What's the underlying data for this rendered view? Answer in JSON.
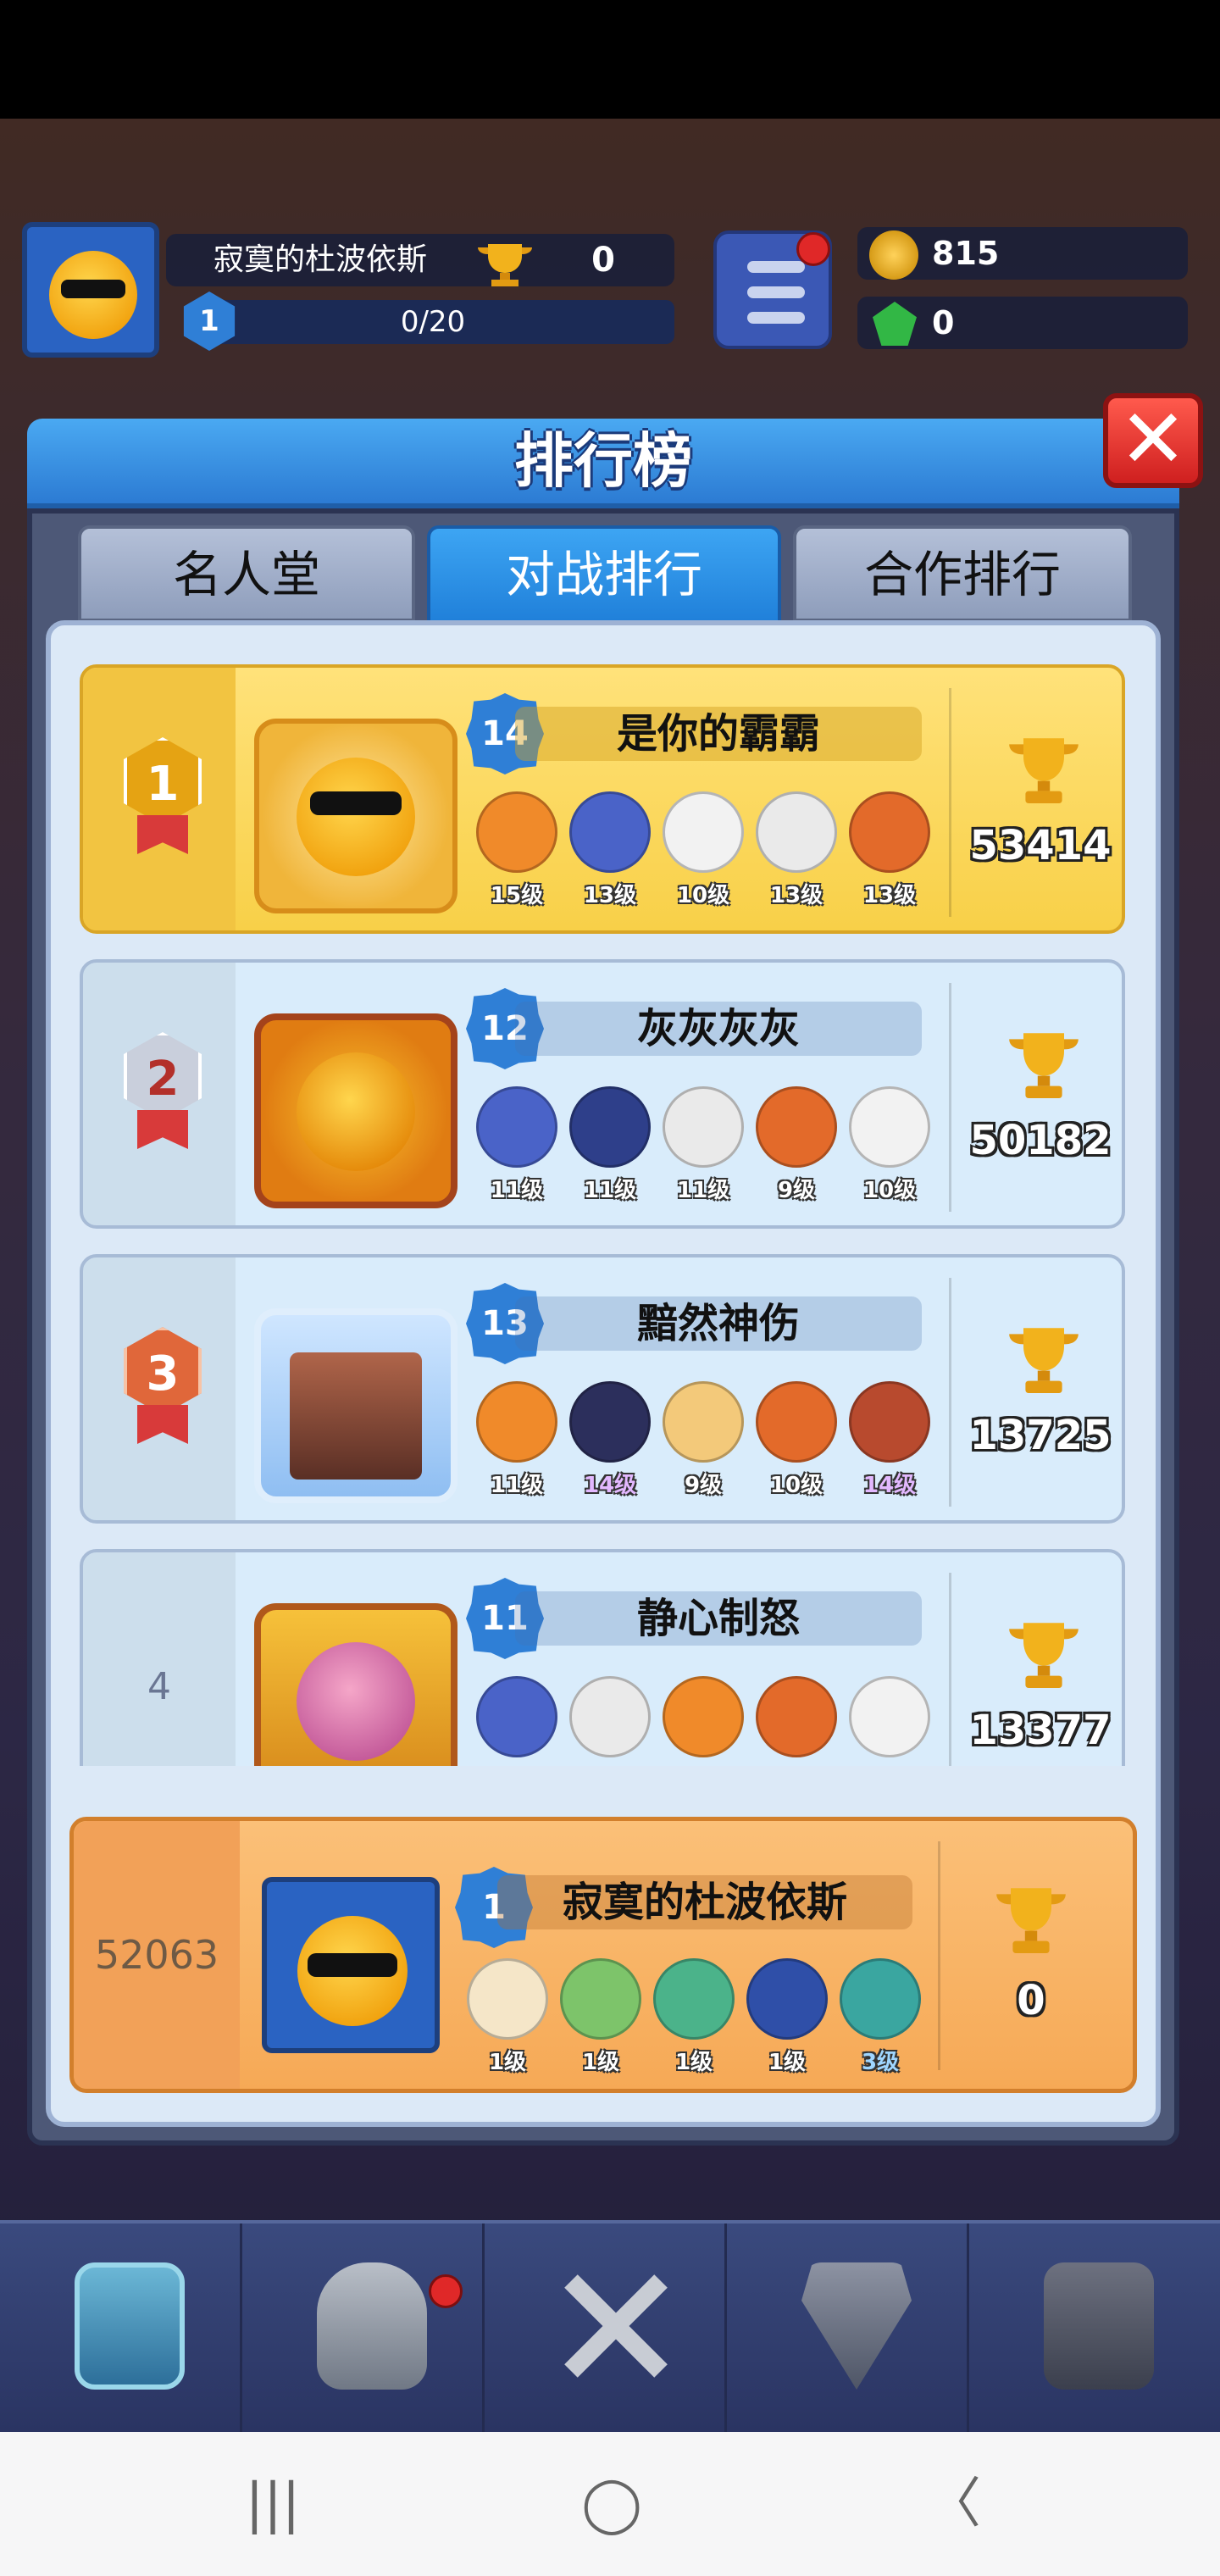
{
  "hud": {
    "player_name": "寂寞的杜波依斯",
    "trophies": "0",
    "level": "1",
    "xp": "0/20",
    "coins": "815",
    "gems": "0"
  },
  "panel": {
    "title": "排行榜",
    "close_label": "✕",
    "tabs": [
      {
        "label": "名人堂"
      },
      {
        "label": "对战排行"
      },
      {
        "label": "合作排行"
      }
    ]
  },
  "leaderboard": [
    {
      "rank": "1",
      "name": "是你的霸霸",
      "level": "14",
      "trophies": "53414",
      "heroes": [
        {
          "lv": "15级",
          "color": "#f08a2a"
        },
        {
          "lv": "13级",
          "color": "#4a63c8"
        },
        {
          "lv": "10级",
          "color": "#f2f2f2"
        },
        {
          "lv": "13级",
          "color": "#eaeaea"
        },
        {
          "lv": "13级",
          "color": "#e36a2a"
        }
      ]
    },
    {
      "rank": "2",
      "name": "灰灰灰灰",
      "level": "12",
      "trophies": "50182",
      "heroes": [
        {
          "lv": "11级",
          "color": "#4a63c8"
        },
        {
          "lv": "11级",
          "color": "#2e3f8a"
        },
        {
          "lv": "11级",
          "color": "#eaeaea"
        },
        {
          "lv": "9级",
          "color": "#e36a2a"
        },
        {
          "lv": "10级",
          "color": "#f2f2f2"
        }
      ]
    },
    {
      "rank": "3",
      "name": "黯然神伤",
      "level": "13",
      "trophies": "13725",
      "heroes": [
        {
          "lv": "11级",
          "color": "#f08a2a"
        },
        {
          "lv": "14级",
          "color": "#2c2f5c"
        },
        {
          "lv": "9级",
          "color": "#f3c97a"
        },
        {
          "lv": "10级",
          "color": "#e36a2a"
        },
        {
          "lv": "14级",
          "color": "#b84a2e"
        }
      ]
    },
    {
      "rank": "4",
      "name": "静心制怒",
      "level": "11",
      "trophies": "13377",
      "heroes": [
        {
          "lv": "",
          "color": "#4a63c8"
        },
        {
          "lv": "",
          "color": "#eaeaea"
        },
        {
          "lv": "",
          "color": "#f08a2a"
        },
        {
          "lv": "",
          "color": "#e36a2a"
        },
        {
          "lv": "",
          "color": "#f2f2f2"
        }
      ]
    }
  ],
  "my_entry": {
    "rank": "52063",
    "name": "寂寞的杜波依斯",
    "level": "1",
    "trophies": "0",
    "heroes": [
      {
        "lv": "1级",
        "color": "#f5e6c8"
      },
      {
        "lv": "1级",
        "color": "#7dc46a"
      },
      {
        "lv": "1级",
        "color": "#4bb38a"
      },
      {
        "lv": "1级",
        "color": "#2f4fa8"
      },
      {
        "lv": "3级",
        "color": "#3aa6a0"
      }
    ]
  },
  "bottom_nav": [
    {
      "name": "chest-icon"
    },
    {
      "name": "helmet-icon"
    },
    {
      "name": "crossed-swords-icon"
    },
    {
      "name": "crown-shield-icon"
    },
    {
      "name": "sprout-icon"
    }
  ],
  "system_nav": {
    "recent": "|||",
    "home": "◯",
    "back": "〈"
  }
}
